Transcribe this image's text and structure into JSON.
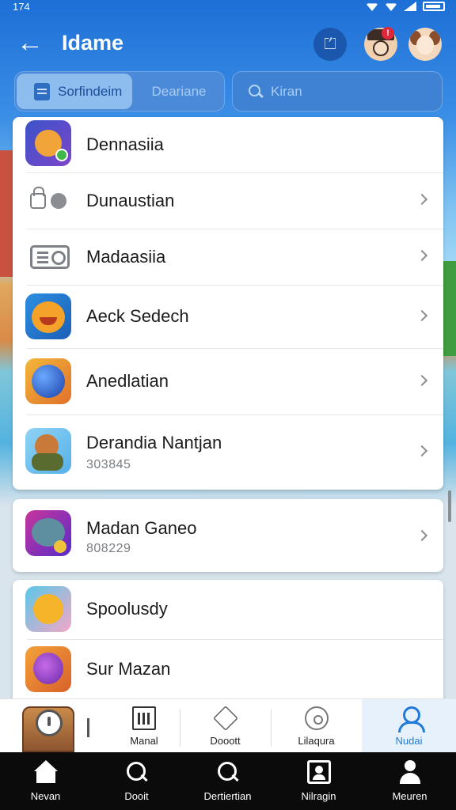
{
  "status_bar": {
    "time": "174"
  },
  "header": {
    "title": "Idame",
    "back_icon": "arrow-left-icon",
    "badge": "!"
  },
  "segment": {
    "tab1_label": "Sorfindeim",
    "tab2_label": "Deariane"
  },
  "search": {
    "placeholder": "Kiran"
  },
  "list_card_1": {
    "rows": [
      {
        "label": "Dennasiia"
      },
      {
        "label": "Dunaustian"
      },
      {
        "label": "Madaasiia"
      },
      {
        "label": "Aeck Sedech"
      },
      {
        "label": "Anedlatian"
      },
      {
        "label": "Derandia Nantjan",
        "sub": "303845"
      }
    ]
  },
  "list_card_2": {
    "label": "Madan Ganeo",
    "sub": "808229"
  },
  "list_card_3": {
    "rows": [
      {
        "label": "Spoolusdy"
      },
      {
        "label": "Sur Mazan"
      }
    ]
  },
  "tabbar": {
    "tabs": [
      {
        "label": "Manal"
      },
      {
        "label": "Dooott"
      },
      {
        "label": "Lilaqura"
      },
      {
        "label": "Nudai"
      }
    ]
  },
  "navbar": {
    "items": [
      {
        "label": "Nevan"
      },
      {
        "label": "Dooit"
      },
      {
        "label": "Dertiertian"
      },
      {
        "label": "Nilragin"
      },
      {
        "label": "Meuren"
      }
    ]
  },
  "colors": {
    "accent": "#1f7bd6",
    "header_bg": "#1f6fd1"
  }
}
